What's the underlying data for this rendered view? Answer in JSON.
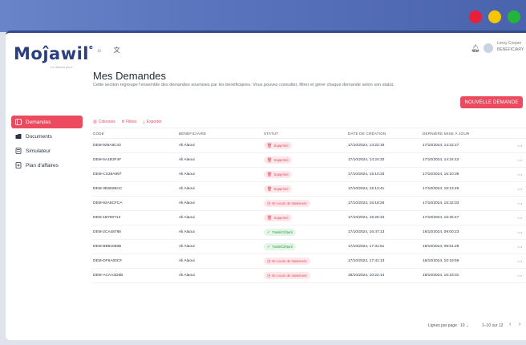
{
  "window": {
    "traffic_lights": [
      "#e81f3a",
      "#f6c700",
      "#23b53b"
    ]
  },
  "brand": {
    "logo": "Moĵawil",
    "logo_sup": "e",
    "tagline": "Le réseau pour..."
  },
  "sidebar": {
    "items": [
      {
        "label": "Demandes",
        "icon": "list-icon",
        "active": true
      },
      {
        "label": "Documents",
        "icon": "folder-icon",
        "active": false
      },
      {
        "label": "Simulateur",
        "icon": "calculator-icon",
        "active": false
      },
      {
        "label": "Plan d'affaires",
        "icon": "document-icon",
        "active": false
      }
    ]
  },
  "topbar": {
    "user_name": "Leroy Cooper",
    "user_role": "BENEFICIARY"
  },
  "page": {
    "title": "Mes Demandes",
    "description": "Cette section regroupe l'ensemble des demandes soumises par les bénéficiaires. Vous pouvez consulter, filtrer et gérer chaque demande selon son statut.",
    "new_button": "NOUVELLE DEMANDE"
  },
  "toolbar": {
    "columns": "Colonnes",
    "filters": "Filtres",
    "export": "Exporter"
  },
  "table": {
    "headers": [
      "CODE",
      "BÉNÉFICIAIRE",
      "STATUT",
      "DATE DE CRÉATION",
      "DERNIÈRE MISE À JOUR"
    ],
    "rows": [
      {
        "code": "DEM-928A8C42",
        "beneficiary": "Ali Alaoui",
        "status": "Supprimé",
        "created": "17/10/2024, 14:22:18",
        "updated": "17/10/2024, 14:22:27"
      },
      {
        "code": "DEM-5A1B3F4F",
        "beneficiary": "Ali Alaoui",
        "status": "Supprimé",
        "created": "17/10/2024, 14:24:32",
        "updated": "17/10/2024, 14:24:42"
      },
      {
        "code": "DEM-CS36A897",
        "beneficiary": "Ali Alaoui",
        "status": "Supprimé",
        "created": "17/10/2024, 15:10:33",
        "updated": "17/10/2024, 15:10:39"
      },
      {
        "code": "DEM-3D682BAC",
        "beneficiary": "Ali Alaoui",
        "status": "Supprimé",
        "created": "17/10/2024, 15:13:41",
        "updated": "17/10/2024, 15:13:46"
      },
      {
        "code": "DEM-92A5CFCA",
        "beneficiary": "Ali Alaoui",
        "status": "En cours de traitement",
        "created": "17/10/2024, 15:18:26",
        "updated": "17/10/2024, 15:32:03"
      },
      {
        "code": "DEM-1B790713",
        "beneficiary": "Ali Alaoui",
        "status": "Supprimé",
        "created": "17/10/2024, 15:25:34",
        "updated": "17/10/2024, 15:25:47"
      },
      {
        "code": "DEM-2CA48786",
        "beneficiary": "Ali Alaoui",
        "status": "Traité/Clôturé",
        "created": "17/10/2024, 16:47:13",
        "updated": "18/10/2024, 09:00:23"
      },
      {
        "code": "DEM-BB91086B",
        "beneficiary": "Ali Alaoui",
        "status": "Traité/Clôturé",
        "created": "17/10/2024, 17:31:51",
        "updated": "18/10/2024, 08:51:28"
      },
      {
        "code": "DEM-DF6A00CF",
        "beneficiary": "Ali Alaoui",
        "status": "En cours de traitement",
        "created": "17/10/2024, 17:41:13",
        "updated": "18/10/2024, 10:19:59"
      },
      {
        "code": "DEM-ACAA2D5B",
        "beneficiary": "Ali Alaoui",
        "status": "En cours de traitement",
        "created": "18/10/2024, 10:22:14",
        "updated": "18/10/2024, 10:23:01"
      }
    ]
  },
  "status_styles": {
    "Supprimé": {
      "bg": "#fde7ea",
      "fg": "#e5485d",
      "icon": "trash-icon",
      "glyph": "🗑"
    },
    "En cours de traitement": {
      "bg": "#fde7ea",
      "fg": "#e5485d",
      "icon": "clock-icon",
      "glyph": "◷"
    },
    "Traité/Clôturé": {
      "bg": "#e4f6e6",
      "fg": "#2e9b45",
      "icon": "check-circle-icon",
      "glyph": "✓"
    }
  },
  "pagination": {
    "rows_label": "Lignes par page :",
    "rows_value": "10",
    "range": "1–10 sur 12"
  },
  "colors": {
    "accent": "#ec4a5e",
    "brand": "#2b3f7e"
  }
}
